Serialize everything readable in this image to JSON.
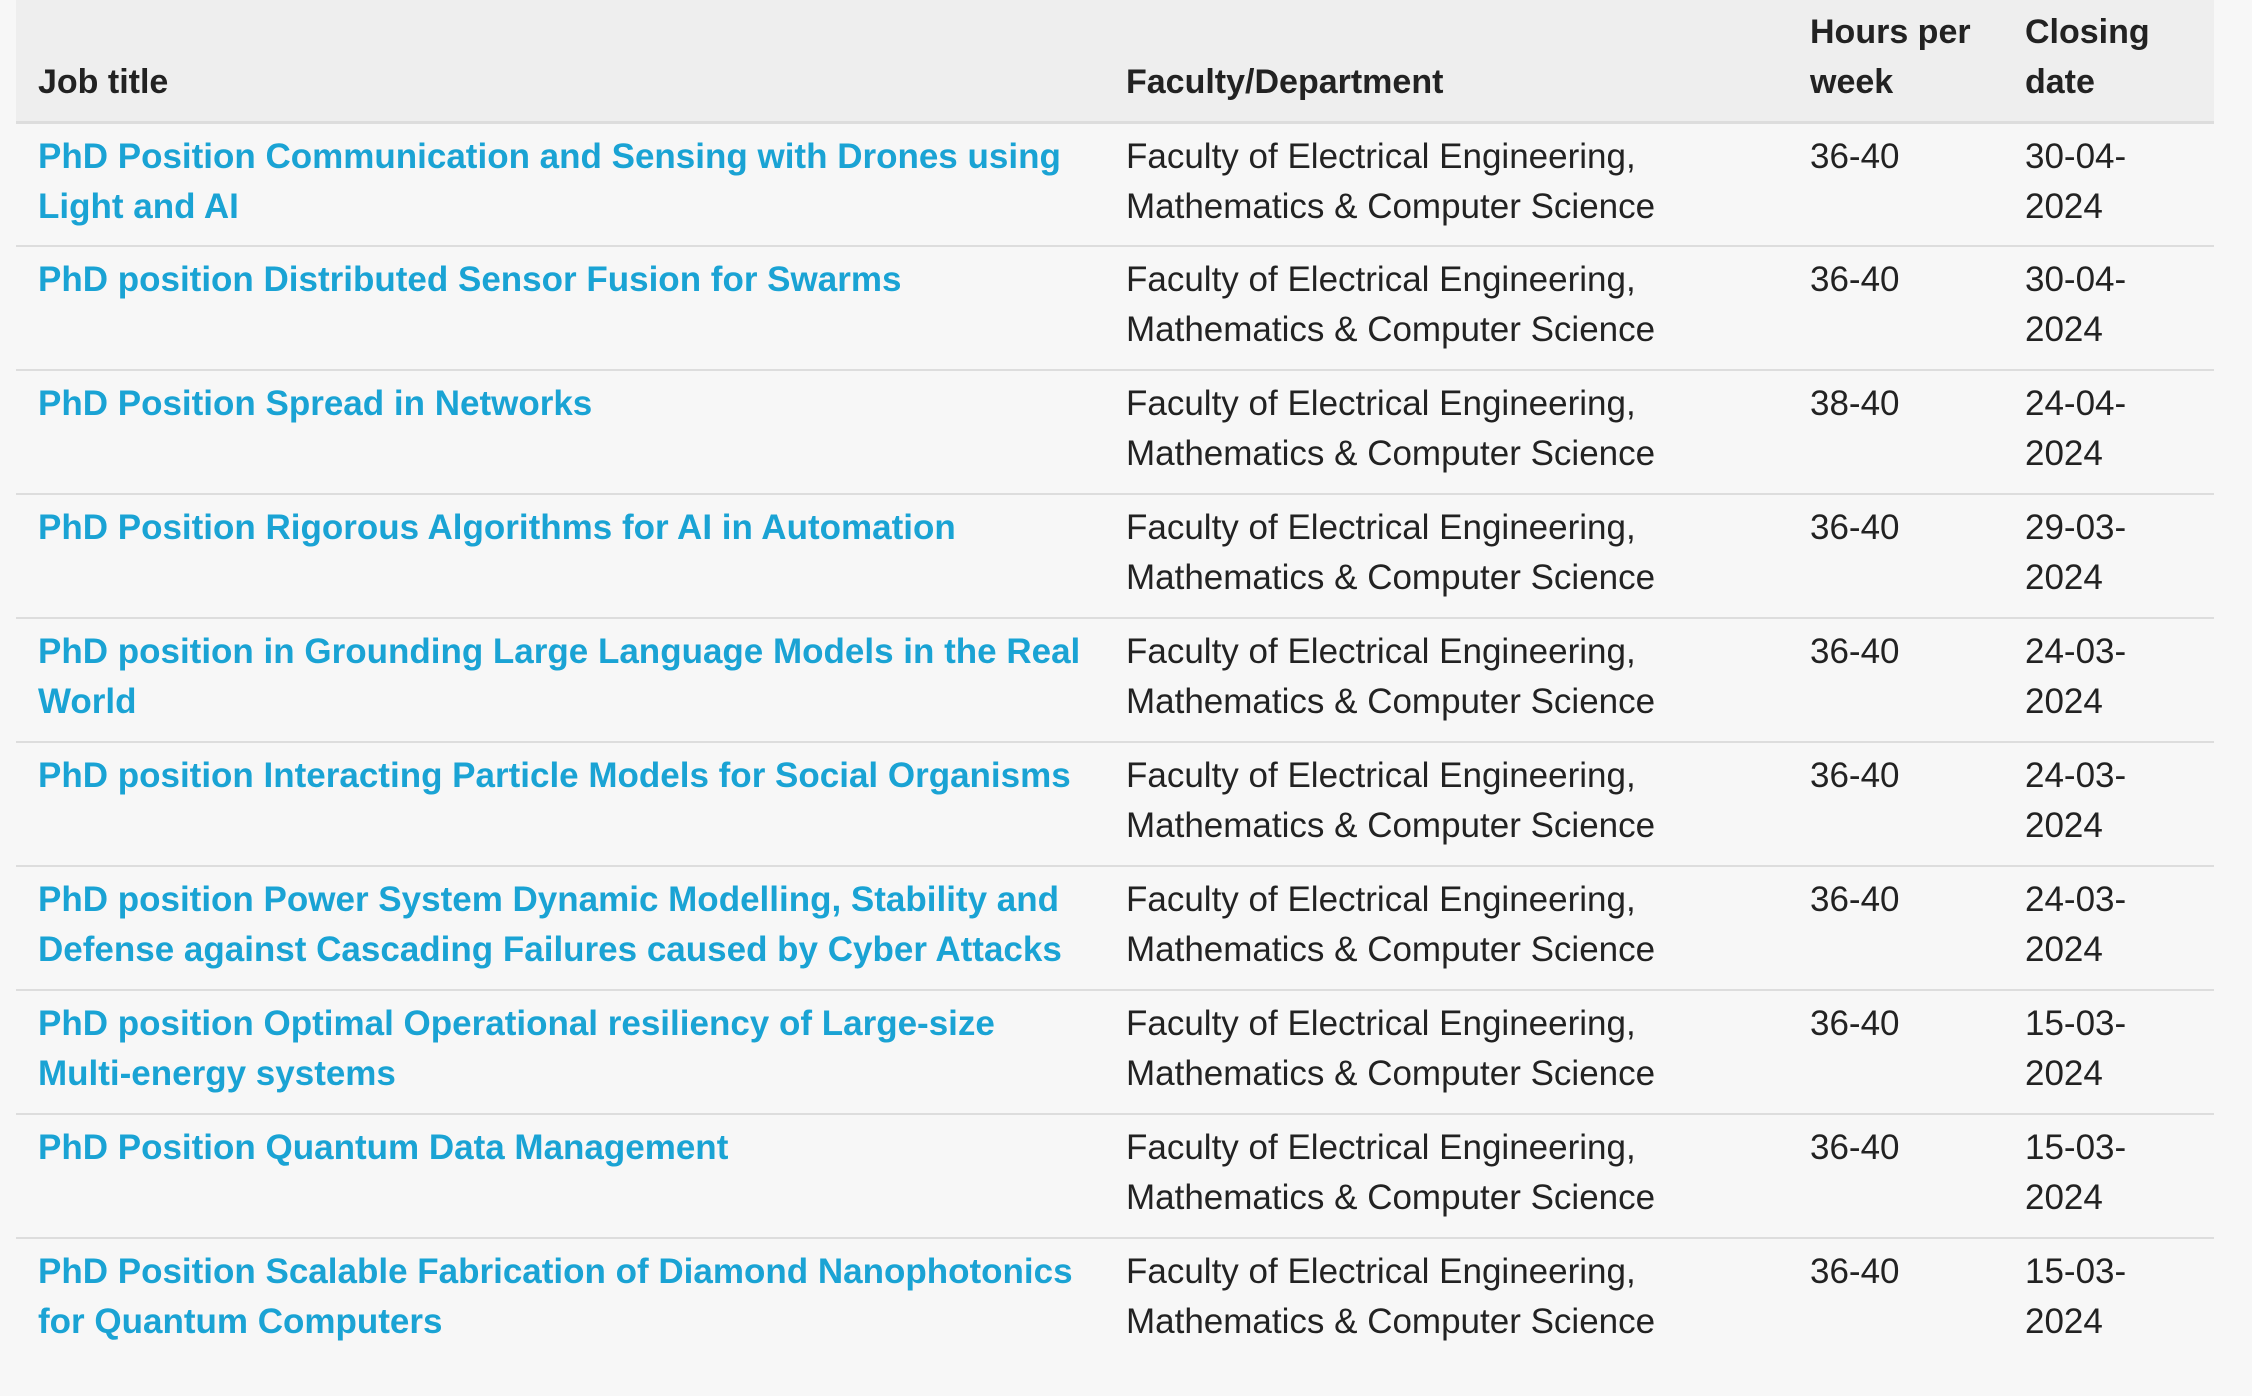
{
  "table": {
    "headers": {
      "job_title": "Job title",
      "faculty": "Faculty/Department",
      "hours": "Hours per week",
      "closing": "Closing date"
    },
    "rows": [
      {
        "title": "PhD Position Communication and Sensing with Drones using Light and AI",
        "faculty": "Faculty of Electrical Engineering, Mathematics & Computer Science",
        "hours": "36-40",
        "closing": "30-04-2024"
      },
      {
        "title": "PhD position Distributed Sensor Fusion for Swarms",
        "faculty": "Faculty of Electrical Engineering, Mathematics & Computer Science",
        "hours": "36-40",
        "closing": "30-04-2024"
      },
      {
        "title": "PhD Position Spread in Networks",
        "faculty": "Faculty of Electrical Engineering, Mathematics & Computer Science",
        "hours": "38-40",
        "closing": "24-04-2024"
      },
      {
        "title": "PhD Position Rigorous Algorithms for AI in Automation",
        "faculty": "Faculty of Electrical Engineering, Mathematics & Computer Science",
        "hours": "36-40",
        "closing": "29-03-2024"
      },
      {
        "title": "PhD position in Grounding Large Language Models in the Real World",
        "faculty": "Faculty of Electrical Engineering, Mathematics & Computer Science",
        "hours": "36-40",
        "closing": "24-03-2024"
      },
      {
        "title": "PhD position Interacting Particle Models for Social Organisms",
        "faculty": "Faculty of Electrical Engineering, Mathematics & Computer Science",
        "hours": "36-40",
        "closing": "24-03-2024"
      },
      {
        "title": "PhD position Power System Dynamic Modelling, Stability and Defense against Cascading Failures caused by Cyber Attacks",
        "faculty": "Faculty of Electrical Engineering, Mathematics & Computer Science",
        "hours": "36-40",
        "closing": "24-03-2024"
      },
      {
        "title": "PhD position Optimal Operational resiliency of Large-size Multi-energy systems",
        "faculty": "Faculty of Electrical Engineering, Mathematics & Computer Science",
        "hours": "36-40",
        "closing": "15-03-2024"
      },
      {
        "title": "PhD Position Quantum Data Management",
        "faculty": "Faculty of Electrical Engineering, Mathematics & Computer Science",
        "hours": "36-40",
        "closing": "15-03-2024"
      },
      {
        "title": "PhD Position Scalable Fabrication of Diamond Nanophotonics for Quantum Computers",
        "faculty": "Faculty of Electrical Engineering, Mathematics & Computer Science",
        "hours": "36-40",
        "closing": "15-03-2024"
      }
    ]
  },
  "colors": {
    "link": "#1aa3d4",
    "text": "#222222",
    "background": "#f7f7f7",
    "header_background": "#eeeeee",
    "divider": "#dddddd"
  }
}
